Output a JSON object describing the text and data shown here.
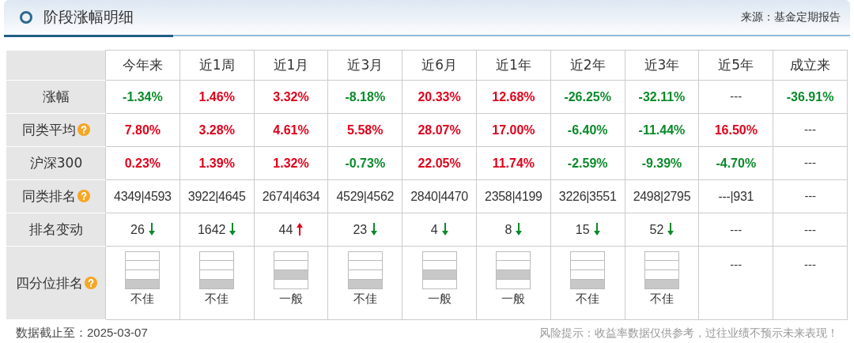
{
  "panel": {
    "title": "阶段涨幅明细",
    "source": "来源：基金定期报告"
  },
  "table": {
    "columns": [
      "今年来",
      "近1周",
      "近1月",
      "近3月",
      "近6月",
      "近1年",
      "近2年",
      "近3年",
      "近5年",
      "成立来"
    ],
    "rows": [
      {
        "kind": "returns",
        "label": "涨幅",
        "help": false,
        "cells": [
          {
            "text": "-1.34%",
            "color": "#0a8a2a"
          },
          {
            "text": "1.46%",
            "color": "#e0001b"
          },
          {
            "text": "3.32%",
            "color": "#e0001b"
          },
          {
            "text": "-8.18%",
            "color": "#0a8a2a"
          },
          {
            "text": "20.33%",
            "color": "#e0001b"
          },
          {
            "text": "12.68%",
            "color": "#e0001b"
          },
          {
            "text": "-26.25%",
            "color": "#0a8a2a"
          },
          {
            "text": "-32.11%",
            "color": "#0a8a2a"
          },
          {
            "text": "---"
          },
          {
            "text": "-36.91%",
            "color": "#0a8a2a"
          }
        ]
      },
      {
        "kind": "returns",
        "label": "同类平均",
        "help": true,
        "cells": [
          {
            "text": "7.80%",
            "color": "#e0001b"
          },
          {
            "text": "3.28%",
            "color": "#e0001b"
          },
          {
            "text": "4.61%",
            "color": "#e0001b"
          },
          {
            "text": "5.58%",
            "color": "#e0001b"
          },
          {
            "text": "28.07%",
            "color": "#e0001b"
          },
          {
            "text": "17.00%",
            "color": "#e0001b"
          },
          {
            "text": "-6.40%",
            "color": "#0a8a2a"
          },
          {
            "text": "-11.44%",
            "color": "#0a8a2a"
          },
          {
            "text": "16.50%",
            "color": "#e0001b"
          },
          {
            "text": "---"
          }
        ]
      },
      {
        "kind": "returns",
        "label": "沪深300",
        "help": false,
        "cells": [
          {
            "text": "0.23%",
            "color": "#e0001b"
          },
          {
            "text": "1.39%",
            "color": "#e0001b"
          },
          {
            "text": "1.32%",
            "color": "#e0001b"
          },
          {
            "text": "-0.73%",
            "color": "#0a8a2a"
          },
          {
            "text": "22.05%",
            "color": "#e0001b"
          },
          {
            "text": "11.74%",
            "color": "#e0001b"
          },
          {
            "text": "-2.59%",
            "color": "#0a8a2a"
          },
          {
            "text": "-9.39%",
            "color": "#0a8a2a"
          },
          {
            "text": "-4.70%",
            "color": "#0a8a2a"
          },
          {
            "text": "---"
          }
        ]
      },
      {
        "kind": "rank",
        "label": "同类排名",
        "help": true,
        "cells": [
          {
            "text": "4349|4593"
          },
          {
            "text": "3922|4645"
          },
          {
            "text": "2674|4634"
          },
          {
            "text": "4529|4562"
          },
          {
            "text": "2840|4470"
          },
          {
            "text": "2358|4199"
          },
          {
            "text": "3226|3551"
          },
          {
            "text": "2498|2795"
          },
          {
            "text": "---|931"
          },
          {
            "text": "---"
          }
        ]
      },
      {
        "kind": "change",
        "label": "排名变动",
        "help": false,
        "cells": [
          {
            "text": "26",
            "rising": false,
            "color": "#0a8a2a"
          },
          {
            "text": "1642",
            "rising": false,
            "color": "#0a8a2a"
          },
          {
            "text": "44",
            "rising": true,
            "color": "#e0001b"
          },
          {
            "text": "23",
            "rising": false,
            "color": "#0a8a2a"
          },
          {
            "text": "4",
            "rising": false,
            "color": "#0a8a2a"
          },
          {
            "text": "8",
            "rising": false,
            "color": "#0a8a2a"
          },
          {
            "text": "15",
            "rising": false,
            "color": "#0a8a2a"
          },
          {
            "text": "52",
            "rising": false,
            "color": "#0a8a2a"
          },
          {
            "text": "---"
          },
          {
            "text": "---"
          }
        ]
      },
      {
        "kind": "quartile",
        "label": "四分位排名",
        "help": true,
        "cells": [
          {
            "segments": [
              {
                "filled": false
              },
              {
                "filled": false
              },
              {
                "filled": false
              },
              {
                "filled": true
              }
            ],
            "text": "不佳"
          },
          {
            "segments": [
              {
                "filled": false
              },
              {
                "filled": false
              },
              {
                "filled": false
              },
              {
                "filled": true
              }
            ],
            "text": "不佳"
          },
          {
            "segments": [
              {
                "filled": false
              },
              {
                "filled": false
              },
              {
                "filled": true
              },
              {
                "filled": false
              }
            ],
            "text": "一般"
          },
          {
            "segments": [
              {
                "filled": false
              },
              {
                "filled": false
              },
              {
                "filled": false
              },
              {
                "filled": true
              }
            ],
            "text": "不佳"
          },
          {
            "segments": [
              {
                "filled": false
              },
              {
                "filled": false
              },
              {
                "filled": true
              },
              {
                "filled": false
              }
            ],
            "text": "一般"
          },
          {
            "segments": [
              {
                "filled": false
              },
              {
                "filled": false
              },
              {
                "filled": true
              },
              {
                "filled": false
              }
            ],
            "text": "一般"
          },
          {
            "segments": [
              {
                "filled": false
              },
              {
                "filled": false
              },
              {
                "filled": false
              },
              {
                "filled": true
              }
            ],
            "text": "不佳"
          },
          {
            "segments": [
              {
                "filled": false
              },
              {
                "filled": false
              },
              {
                "filled": false
              },
              {
                "filled": true
              }
            ],
            "text": "不佳"
          },
          {
            "text": "---"
          },
          {
            "text": "---"
          }
        ]
      }
    ]
  },
  "footer": {
    "date": "数据截止至：2025-03-07",
    "risk_note": "风险提示：收益率数据仅供参考，过往业绩不预示未来表现！"
  }
}
